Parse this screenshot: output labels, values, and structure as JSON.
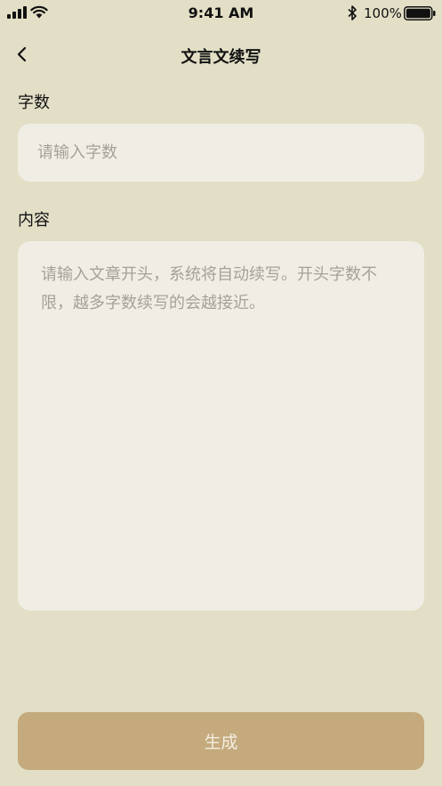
{
  "status_bar": {
    "time": "9:41 AM",
    "battery_percent": "100%",
    "icons": [
      "signal-icon",
      "wifi-icon",
      "bluetooth-icon",
      "battery-icon"
    ]
  },
  "nav": {
    "title": "文言文续写",
    "back_icon": "chevron-left-icon"
  },
  "form": {
    "count_label": "字数",
    "count_placeholder": "请输入字数",
    "count_value": "",
    "content_label": "内容",
    "content_placeholder": "请输入文章开头，系统将自动续写。开头字数不限，越多字数续写的会越接近。",
    "content_value": ""
  },
  "actions": {
    "generate_label": "生成"
  },
  "colors": {
    "background": "#e2dfc6",
    "field_background": "#f0eee4",
    "placeholder": "#a3a19a",
    "button": "#c4aa7d",
    "button_text": "#f4eee2"
  }
}
